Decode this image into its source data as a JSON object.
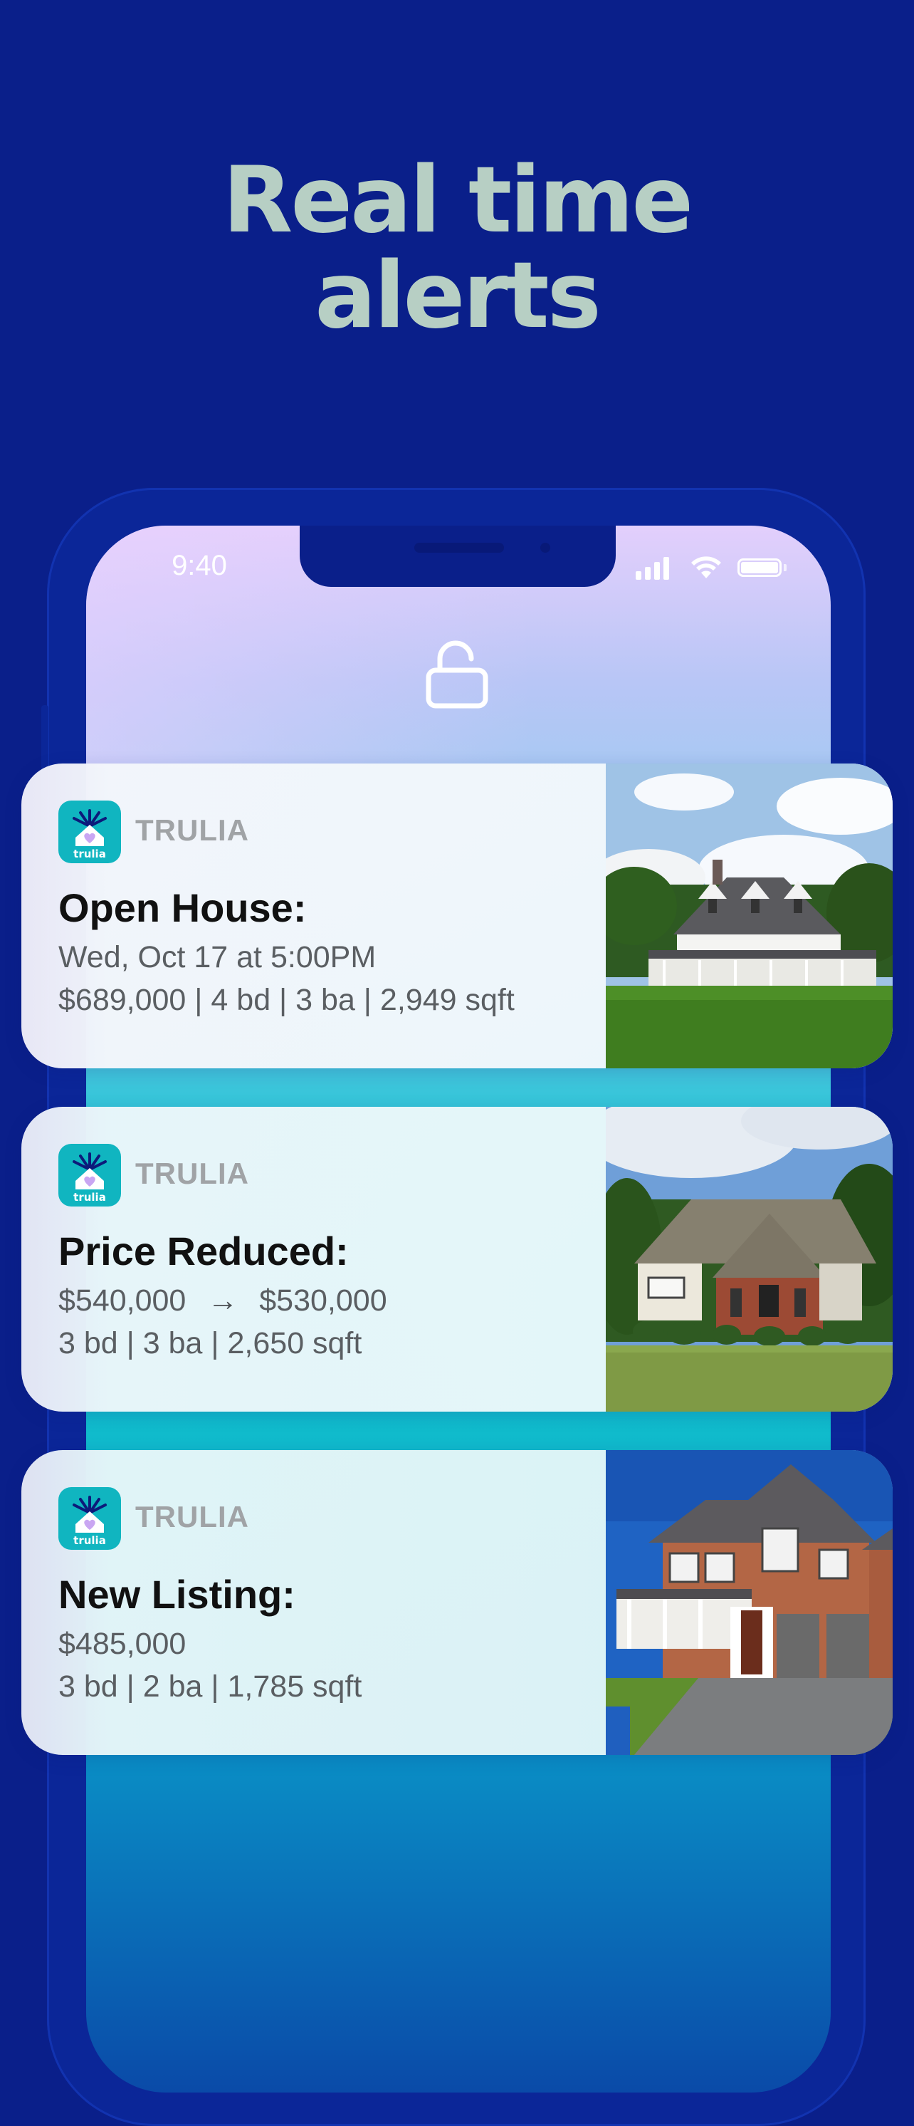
{
  "headline": {
    "line1": "Real time",
    "line2": "alerts"
  },
  "status_bar": {
    "time": "9:40"
  },
  "notifications": [
    {
      "app": "TRULIA",
      "app_icon_label": "trulia",
      "title": "Open House:",
      "line1": "Wed, Oct 17 at 5:00PM",
      "line2": "$689,000 | 4 bd | 3 ba | 2,949 sqft",
      "photo": "white-farmhouse-photo"
    },
    {
      "app": "TRULIA",
      "app_icon_label": "trulia",
      "title": "Price Reduced:",
      "old_price": "$540,000",
      "arrow": "→",
      "new_price": "$530,000",
      "line2": "3 bd | 3 ba | 2,650 sqft",
      "photo": "brick-house-photo"
    },
    {
      "app": "TRULIA",
      "app_icon_label": "trulia",
      "title": "New Listing:",
      "line1": "$485,000",
      "line2": "3 bd | 2 ba | 1,785 sqft",
      "photo": "brick-two-story-house-photo"
    }
  ],
  "colors": {
    "background": "#0a1f8a",
    "headline": "#b7cfc4",
    "app_icon": "#10b5c0"
  }
}
